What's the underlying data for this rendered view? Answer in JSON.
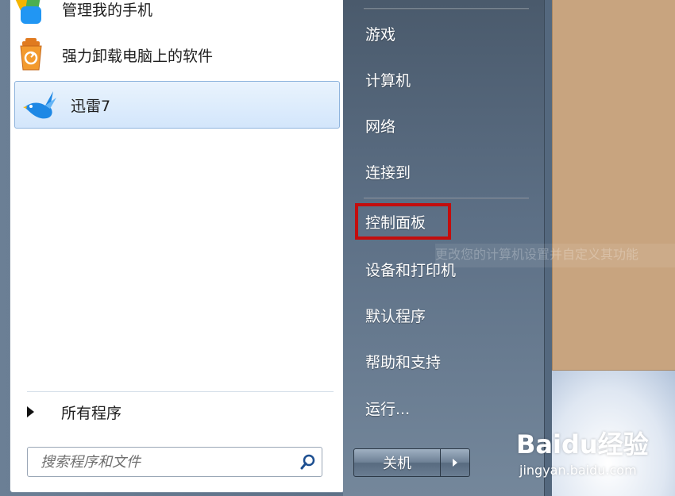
{
  "programs": [
    {
      "label": "管理我的手机",
      "icon": "phone-manager-icon"
    },
    {
      "label": "强力卸载电脑上的软件",
      "icon": "uninstaller-icon"
    },
    {
      "label": "迅雷7",
      "icon": "xunlei-bird-icon",
      "selected": true
    }
  ],
  "all_programs_label": "所有程序",
  "search": {
    "placeholder": "搜索程序和文件"
  },
  "right_menu": [
    {
      "label": "游戏"
    },
    {
      "label": "计算机"
    },
    {
      "label": "网络"
    },
    {
      "label": "连接到"
    },
    {
      "label": "控制面板",
      "highlighted": true
    },
    {
      "label": "设备和打印机"
    },
    {
      "label": "默认程序"
    },
    {
      "label": "帮助和支持"
    },
    {
      "label": "运行..."
    }
  ],
  "tooltip_text": "更改您的计算机设置并自定义其功能",
  "shutdown": {
    "label": "关机"
  },
  "watermark": {
    "logo": "Baidu经验",
    "url": "jingyan.baidu.com"
  },
  "colors": {
    "highlight_border": "#c30d0d",
    "selection_bg": "#d3e6fb",
    "desktop_window": "#c8a47f"
  }
}
